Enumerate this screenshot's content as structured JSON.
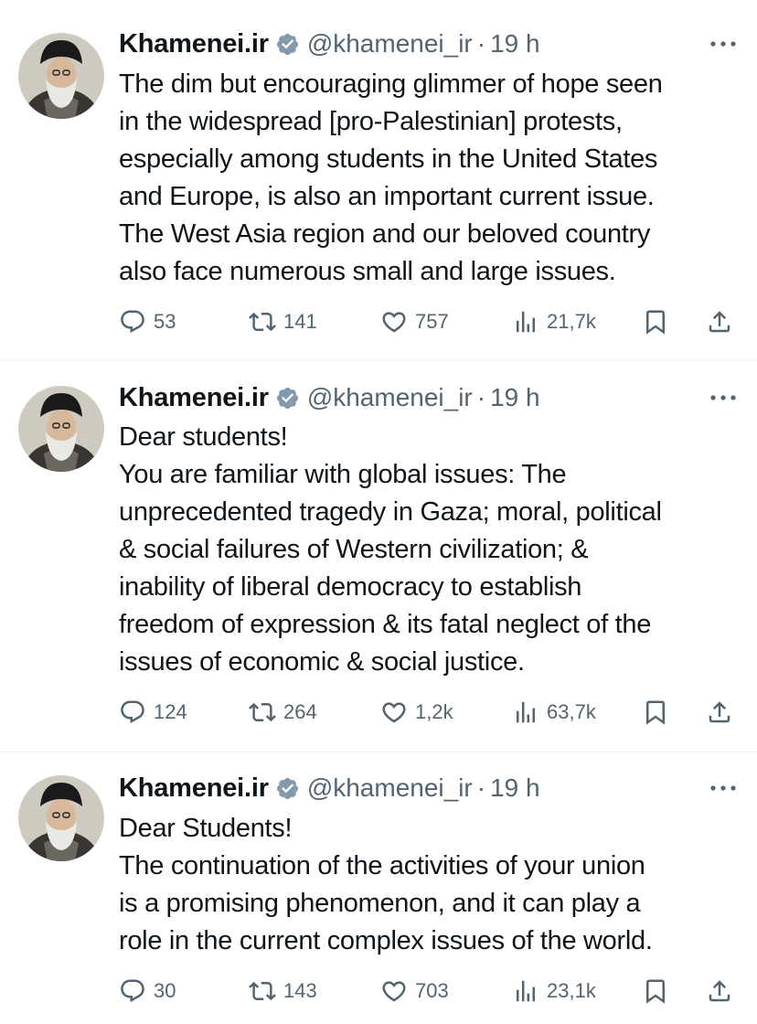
{
  "tweets": [
    {
      "name": "Khamenei.ir",
      "handle": "@khamenei_ir",
      "separator": "·",
      "time": "19 h",
      "text": "The dim but encouraging glimmer of hope seen\nin the widespread [pro-Palestinian] protests,\nespecially among students in the United States\nand Europe, is also an important current issue.\nThe West Asia region and our beloved country\nalso face numerous small and large issues.",
      "replies": "53",
      "retweets": "141",
      "likes": "757",
      "views": "21,7k"
    },
    {
      "name": "Khamenei.ir",
      "handle": "@khamenei_ir",
      "separator": "·",
      "time": "19 h",
      "text": "Dear students!\nYou are familiar with global issues: The\nunprecedented tragedy in Gaza; moral, political\n& social failures of Western civilization; &\ninability of liberal democracy to establish\nfreedom of expression & its fatal neglect of the\nissues of economic & social justice.",
      "replies": "124",
      "retweets": "264",
      "likes": "1,2k",
      "views": "63,7k"
    },
    {
      "name": "Khamenei.ir",
      "handle": "@khamenei_ir",
      "separator": "·",
      "time": "19 h",
      "text": "Dear Students!\nThe continuation of the activities of your union\nis a promising phenomenon, and it can play a\nrole in the current complex issues of the world.",
      "replies": "30",
      "retweets": "143",
      "likes": "703",
      "views": "23,1k"
    }
  ],
  "icons": {
    "verified": "verified-badge-icon",
    "more": "more-dots-icon",
    "reply": "reply-bubble-icon",
    "retweet": "retweet-arrows-icon",
    "like": "heart-icon",
    "views": "bar-chart-icon",
    "bookmark": "bookmark-icon",
    "share": "share-upload-icon"
  },
  "colors": {
    "text": "#0f1419",
    "secondary": "#536471",
    "verified_badge": "#829aab",
    "separator": "#eff3f4"
  }
}
